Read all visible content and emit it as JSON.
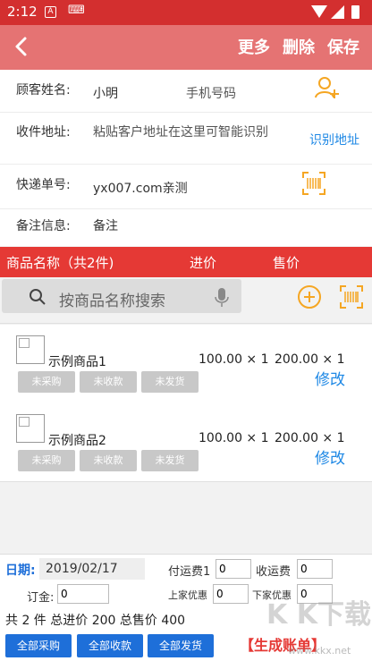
{
  "status_bar": {
    "time": "2:12",
    "notif_icons": [
      "A",
      "⌨"
    ]
  },
  "app_bar": {
    "actions": [
      "更多",
      "删除",
      "保存"
    ]
  },
  "form": {
    "customer_label": "顾客姓名:",
    "customer_value": "小明",
    "phone_placeholder": "手机号码",
    "address_label": "收件地址:",
    "address_placeholder": "粘贴客户地址在这里可智能识别",
    "address_recognize": "识别地址",
    "tracking_label": "快递单号:",
    "tracking_value": "yx007.com亲测",
    "remark_label": "备注信息:",
    "remark_placeholder": "备注"
  },
  "table_header": {
    "name": "商品名称（共2件)",
    "buy": "进价",
    "sell": "售价"
  },
  "search": {
    "placeholder": "按商品名称搜索"
  },
  "products": [
    {
      "name": "示例商品1",
      "buy": "100.00 × 1",
      "sell": "200.00 × 1",
      "edit": "修改",
      "tags": [
        "未采购",
        "未收款",
        "未发货"
      ]
    },
    {
      "name": "示例商品2",
      "buy": "100.00 × 1",
      "sell": "200.00 × 1",
      "edit": "修改",
      "tags": [
        "未采购",
        "未收款",
        "未发货"
      ]
    }
  ],
  "footer": {
    "date_label": "日期:",
    "date_value": "2019/02/17",
    "pay_ship_label": "付运费1",
    "pay_ship_value": "0",
    "recv_ship_label": "收运费",
    "recv_ship_value": "0",
    "deposit_label": "订金:",
    "deposit_value": "0",
    "up_discount_label": "上家优惠",
    "up_discount_value": "0",
    "down_discount_label": "下家优惠",
    "down_discount_value": "0",
    "summary": "共 2 件 总进价 200 总售价 400",
    "btn_all_buy": "全部采购",
    "btn_all_recv": "全部收款",
    "btn_all_ship": "全部发货",
    "generate": "【生成账单】"
  },
  "watermark": {
    "text": "K K下载",
    "url": "www.kkx.net"
  },
  "colors": {
    "primary_red": "#e53935",
    "appbar_red": "#e57373",
    "link_blue": "#1e88e5",
    "icon_orange": "#f5a623",
    "button_blue": "#1e6fd9"
  }
}
